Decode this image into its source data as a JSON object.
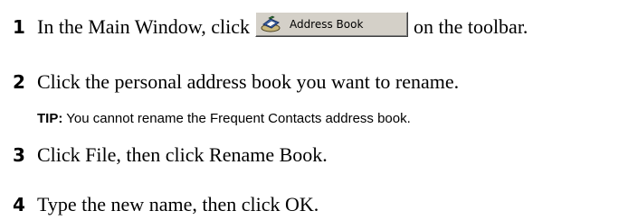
{
  "steps": [
    {
      "number": "1",
      "text_before": "In the Main Window, click",
      "button_label": "Address Book",
      "button_icon": "address-book-icon",
      "text_after": "on the toolbar."
    },
    {
      "number": "2",
      "text": "Click the personal address book you want to rename."
    },
    {
      "number": "3",
      "text": "Click File, then click Rename Book."
    },
    {
      "number": "4",
      "text": "Type the new name, then click OK."
    }
  ],
  "tip": {
    "label": "TIP:",
    "text": "You cannot rename the Frequent Contacts address book."
  }
}
